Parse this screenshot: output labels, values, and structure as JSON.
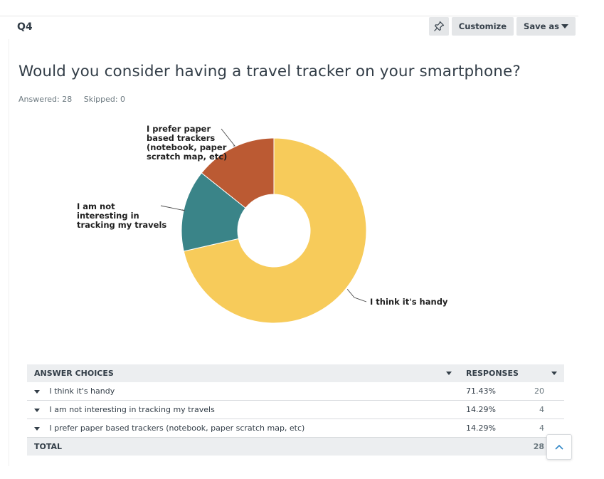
{
  "question": {
    "number": "Q4",
    "title": "Would you consider having a travel tracker on your smartphone?",
    "answered": "Answered: 28",
    "skipped": "Skipped: 0"
  },
  "toolbar": {
    "pin_icon": "pin-icon",
    "customize_label": "Customize",
    "save_as_label": "Save as"
  },
  "chart_data": {
    "type": "pie",
    "donut": true,
    "categories": [
      "I think it's handy",
      "I am not interesting in tracking my travels",
      "I prefer paper based trackers (notebook, paper scratch map, etc)"
    ],
    "values": [
      71.43,
      14.29,
      14.29
    ],
    "colors": [
      "#f7cb5a",
      "#3a8488",
      "#bb5a33"
    ],
    "labels": [
      [
        "I think it's handy"
      ],
      [
        "I am not",
        "interesting in",
        "tracking my travels"
      ],
      [
        "I prefer paper",
        "based trackers",
        "(notebook, paper",
        "scratch map, etc)"
      ]
    ]
  },
  "table": {
    "headers": {
      "choices": "ANSWER CHOICES",
      "responses": "RESPONSES"
    },
    "rows": [
      {
        "choice": "I think it's handy",
        "percent": "71.43%",
        "count": "20"
      },
      {
        "choice": "I am not interesting in tracking my travels",
        "percent": "14.29%",
        "count": "4"
      },
      {
        "choice": "I prefer paper based trackers (notebook, paper scratch map, etc)",
        "percent": "14.29%",
        "count": "4"
      }
    ],
    "total_label": "TOTAL",
    "total_count": "28"
  }
}
